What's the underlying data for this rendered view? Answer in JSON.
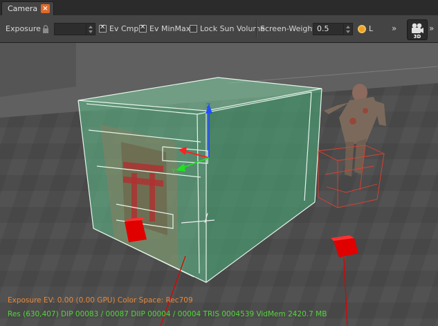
{
  "tab": {
    "label": "Camera",
    "close_glyph": "×"
  },
  "toolbar": {
    "exposure_label": "Exposure",
    "exposure_value": "",
    "ev_cmp_label": "Ev Cmp",
    "ev_cmp_checked": true,
    "ev_minmax_label": "Ev MinMax",
    "ev_minmax_checked": true,
    "lock_sun_label": "Lock Sun Volume",
    "lock_sun_checked": false,
    "screen_weight_label": "Screen-Weight",
    "screen_weight_value": "0.5",
    "radio_label": "L",
    "more_glyph": "»",
    "view_mode_badge": "3D"
  },
  "hud": {
    "exposure_line": "Exposure EV: 0.00 (0.00 GPU)  Color Space: Rec709",
    "stats_line": "Res (630,407)   DIP 00083 / 00087  DIIP 00004 / 00004  TRIS 0004539  VidMem 2420.7 MB"
  },
  "colors": {
    "exposure_text": "#e8883a",
    "stats_text": "#55d43c",
    "accent": "#f0a020",
    "volume_fill": "#5fbf8c",
    "axis_x": "#ff2020",
    "axis_y": "#22e022",
    "axis_z": "#2050ff"
  }
}
